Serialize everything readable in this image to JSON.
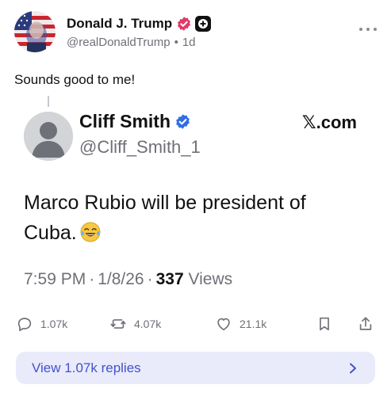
{
  "post": {
    "display_name": "Donald J. Trump",
    "handle": "@realDonaldTrump",
    "separator": "•",
    "time_ago": "1d",
    "text": "Sounds good to me!",
    "avatar_icon": "flag-portrait-avatar",
    "more_icon": "more-horizontal-icon"
  },
  "quote": {
    "display_name": "Cliff Smith",
    "handle": "@Cliff_Smith_1",
    "brand": "𝕏.com",
    "text": "Marco Rubio will be president of Cuba.",
    "emoji_icon": "laughing-tears-emoji",
    "time": "7:59 PM",
    "date": "1/8/26",
    "meta_separator": "·",
    "views_count": "337",
    "views_label": "Views"
  },
  "actions": {
    "replies": "1.07k",
    "reposts": "4.07k",
    "likes": "21.1k"
  },
  "replies_bar": {
    "label": "View 1.07k replies"
  },
  "colors": {
    "verified": "#2f6fe4",
    "accent_text": "#4452c9",
    "bar_bg": "#e9ebfb",
    "muted": "#6f6f78"
  }
}
